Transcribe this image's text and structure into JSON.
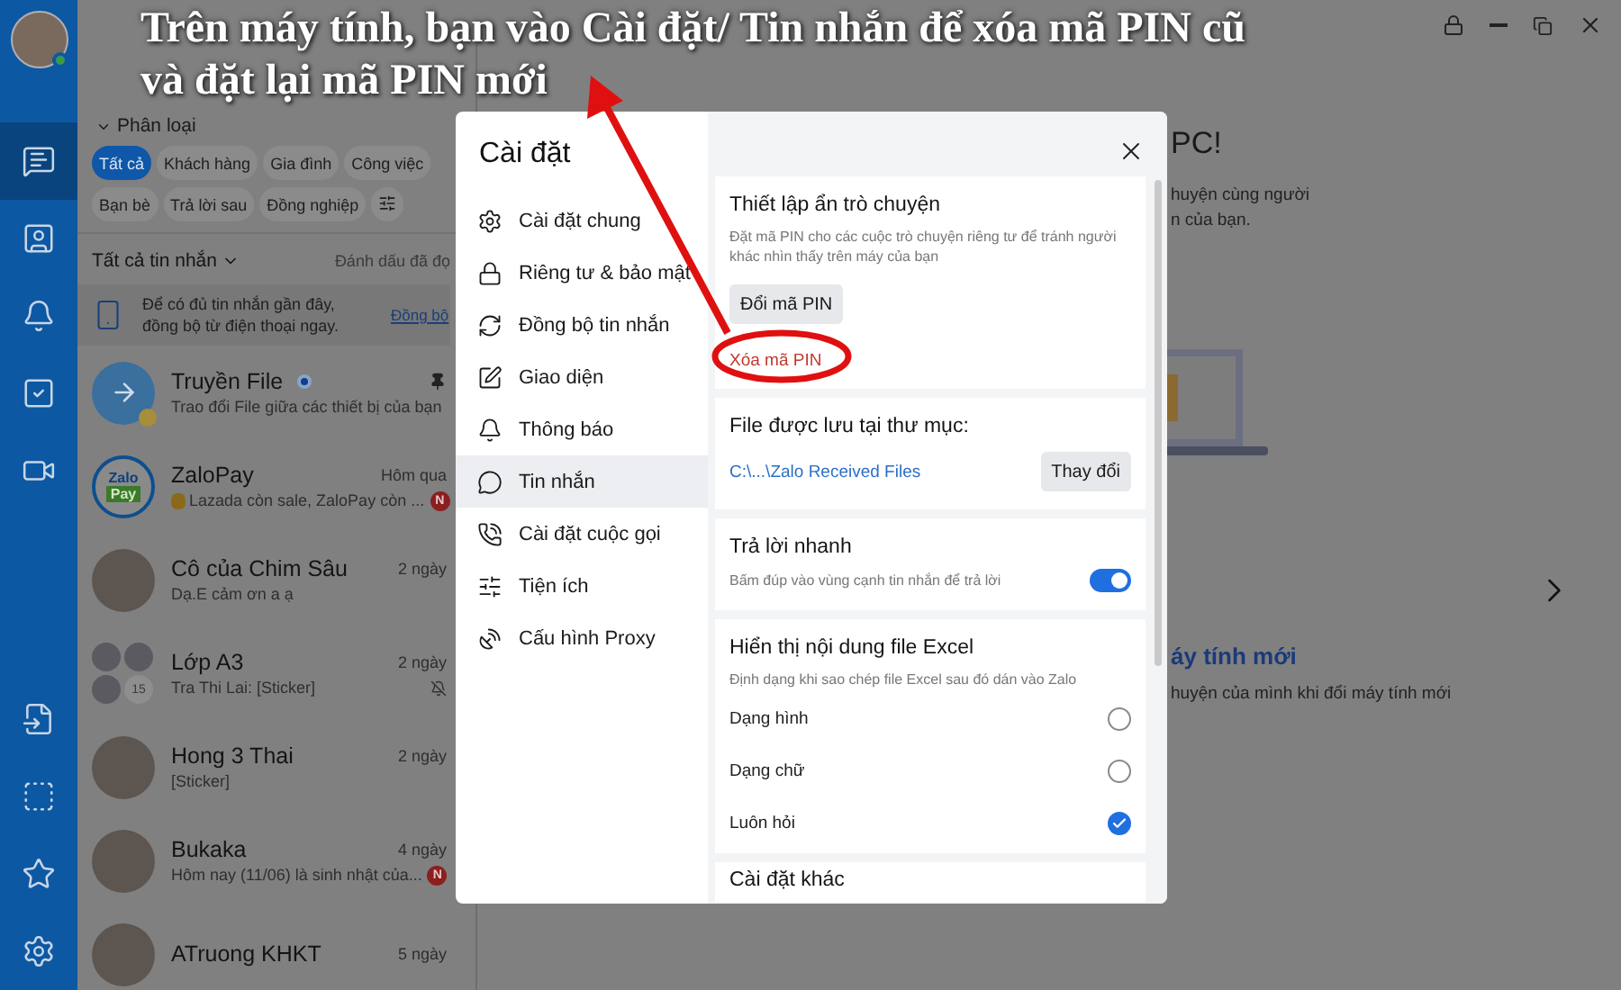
{
  "annotation": {
    "caption_lines": [
      "Trên máy tính, bạn vào Cài đặt/ Tin nhắn để xóa mã PIN cũ",
      "và đặt lại mã PIN mới"
    ]
  },
  "rail": {
    "top": [
      {
        "kind": "chat",
        "selected": true
      },
      {
        "kind": "contacts",
        "selected": false
      },
      {
        "kind": "bell",
        "selected": false
      },
      {
        "kind": "todo",
        "selected": false
      },
      {
        "kind": "video",
        "selected": false
      }
    ],
    "bottom": [
      {
        "kind": "file",
        "selected": false
      },
      {
        "kind": "capture",
        "selected": false
      },
      {
        "kind": "star",
        "selected": false
      },
      {
        "kind": "settings",
        "selected": false
      }
    ]
  },
  "chat_list": {
    "category_label": "Phân loại",
    "chips": [
      {
        "label": "Tất cả",
        "selected": true
      },
      {
        "label": "Khách hàng",
        "selected": false
      },
      {
        "label": "Gia đình",
        "selected": false
      },
      {
        "label": "Công việc",
        "selected": false
      },
      {
        "label": "Bạn bè",
        "selected": false
      },
      {
        "label": "Trả lời sau",
        "selected": false
      },
      {
        "label": "Đồng nghiệp",
        "selected": false
      }
    ],
    "filter": "Tất cả tin nhắn",
    "mark_read": "Đánh dấu đã đọ",
    "sync_banner": {
      "text": "Để có đủ tin nhắn gần đây, đồng bộ từ điện thoại ngay.",
      "link": "Đồng bộ"
    },
    "chats": [
      {
        "name": "Truyền File",
        "preview": "Trao đổi File giữa các thiết bị của bạn",
        "kind": "file",
        "pinned": true,
        "unread_dot": true
      },
      {
        "name": "ZaloPay",
        "preview": "Lazada còn sale, ZaloPay còn ...",
        "time": "Hôm qua",
        "kind": "logo",
        "avatar_text": [
          "Zalo",
          "Pay"
        ],
        "preview_icon": true,
        "badge": "N"
      },
      {
        "name": "Cô của Chim Sâu",
        "preview": "Dạ.E cảm ơn a ạ",
        "time": "2 ngày",
        "kind": "photo"
      },
      {
        "name": "Lớp A3",
        "preview": "Tra Thi Lai: [Sticker]",
        "time": "2 ngày",
        "kind": "group",
        "member_count": "15",
        "muted": true
      },
      {
        "name": "Hong 3 Thai",
        "preview": "[Sticker]",
        "time": "2 ngày",
        "kind": "photo"
      },
      {
        "name": "Bukaka",
        "preview": "Hôm nay (11/06) là sinh nhật của...",
        "time": "4 ngày",
        "kind": "photo",
        "badge": "N"
      },
      {
        "name": "ATruong KHKT",
        "time": "5 ngày",
        "kind": "photo"
      }
    ]
  },
  "welcome": {
    "title": "PC!",
    "lines": [
      "huyện cùng người",
      "n của bạn."
    ],
    "feature_title": "áy tính mới",
    "feature_text": "huyện của mình khi đổi máy tính mới"
  },
  "settings": {
    "title": "Cài đặt",
    "menu": [
      {
        "label": "Cài đặt chung",
        "kind": "general",
        "selected": false
      },
      {
        "label": "Riêng tư & bảo mật",
        "kind": "privacy",
        "selected": false
      },
      {
        "label": "Đồng bộ tin nhắn",
        "kind": "sync",
        "selected": false
      },
      {
        "label": "Giao diện",
        "kind": "appearance",
        "selected": false
      },
      {
        "label": "Thông báo",
        "kind": "notify",
        "selected": false
      },
      {
        "label": "Tin nhắn",
        "kind": "messages",
        "selected": true
      },
      {
        "label": "Cài đặt cuộc gọi",
        "kind": "calls",
        "selected": false
      },
      {
        "label": "Tiện ích",
        "kind": "utilities",
        "selected": false
      },
      {
        "label": "Cấu hình Proxy",
        "kind": "proxy",
        "selected": false
      }
    ],
    "hidden_chats": {
      "title": "Thiết lập ẩn trò chuyện",
      "description": "Đặt mã PIN cho các cuộc trò chuyện riêng tư để tránh người khác nhìn thấy trên máy của bạn",
      "change_button": "Đổi mã PIN",
      "remove_link": "Xóa mã PIN"
    },
    "save_folder": {
      "title": "File được lưu tại thư mục:",
      "path": "C:\\...\\Zalo Received Files",
      "button": "Thay đổi"
    },
    "quick_reply": {
      "title": "Trả lời nhanh",
      "description": "Bấm đúp vào vùng cạnh tin nhắn để trả lời",
      "on": true
    },
    "excel": {
      "title": "Hiển thị nội dung file Excel",
      "description": "Định dạng khi sao chép file Excel sau đó dán vào Zalo",
      "options": [
        {
          "label": "Dạng hình",
          "selected": false
        },
        {
          "label": "Dạng chữ",
          "selected": false
        },
        {
          "label": "Luôn hỏi",
          "selected": true
        }
      ]
    },
    "other_title": "Cài đặt khác"
  }
}
